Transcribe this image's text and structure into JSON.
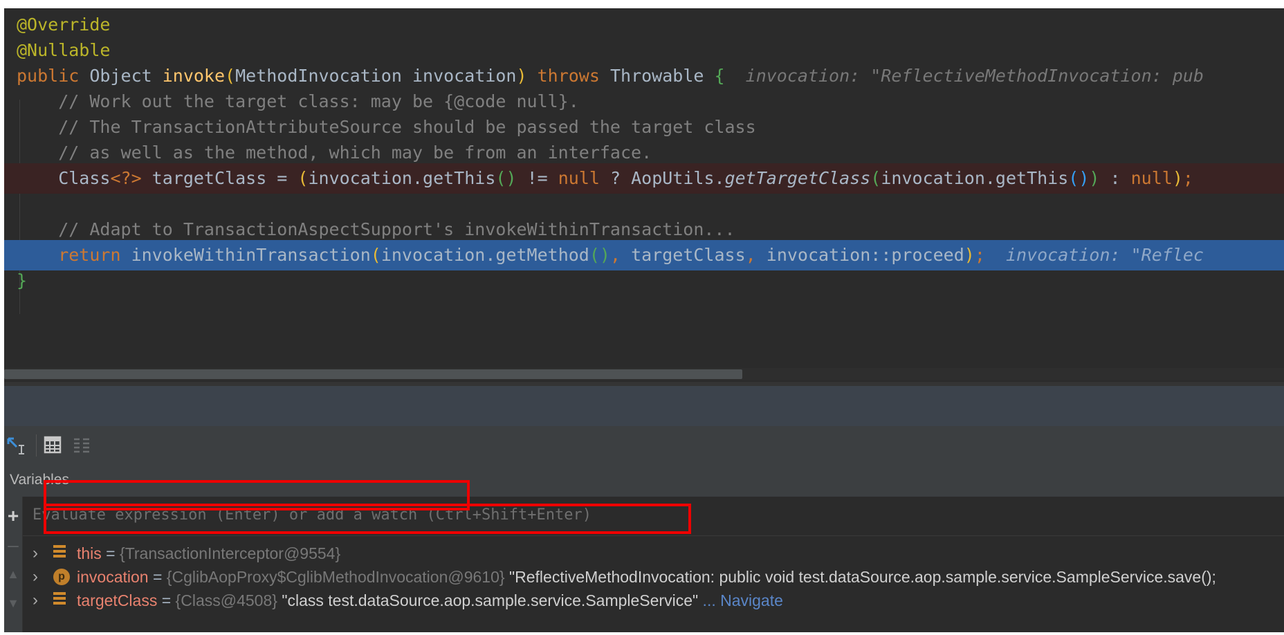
{
  "editor": {
    "lines": {
      "l1": "@Override",
      "l2": "@Nullable",
      "l3_public": "public ",
      "l3_type": "Object ",
      "l3_method": "invoke",
      "l3_open": "(",
      "l3_params": "MethodInvocation invocation",
      "l3_close": ")",
      "l3_throws": " throws ",
      "l3_throwable": "Throwable ",
      "l3_brace": "{",
      "l3_inline": "  invocation: \"ReflectiveMethodInvocation: pub",
      "l4": "    // Work out the target class: may be {@code null}.",
      "l5": "    // The TransactionAttributeSource should be passed the target class",
      "l6": "    // as well as the method, which may be from an interface.",
      "l7_a": "    Class",
      "l7_b": "<?>",
      "l7_c": " targetClass = ",
      "l7_d": "(",
      "l7_e": "invocation.getThis",
      "l7_f": "()",
      "l7_g": " != ",
      "l7_h": "null",
      "l7_i": " ? AopUtils.",
      "l7_j": "getTargetClass",
      "l7_k": "(",
      "l7_l": "invocation.getThis",
      "l7_m": "()",
      "l7_n": ")",
      "l7_o": " : ",
      "l7_p": "null",
      "l7_q": ")",
      "l7_r": ";",
      "l9": "    // Adapt to TransactionAspectSupport's invokeWithinTransaction...",
      "l10_a": "    return ",
      "l10_b": "invokeWithinTransaction",
      "l10_c": "(",
      "l10_d": "invocation.getMethod",
      "l10_e": "()",
      "l10_f": ", ",
      "l10_g": "targetClass",
      "l10_h": ", ",
      "l10_i": "invocation::proceed",
      "l10_j": ")",
      "l10_k": ";",
      "l10_inline": "  invocation: \"Reflec",
      "l11": "}"
    }
  },
  "toolbar": {
    "restore_icon": "restore-layout-icon",
    "table_icon": "table-icon",
    "columns_icon": "columns-icon"
  },
  "variables": {
    "title": "Variables",
    "watch_placeholder": "Evaluate expression (Enter) or add a watch (Ctrl+Shift+Enter)",
    "rows": [
      {
        "name": "this",
        "eq": " = ",
        "type": "{TransactionInterceptor@9554}",
        "value": "",
        "icon": "field-icon"
      },
      {
        "name": "invocation",
        "eq": " = ",
        "type": "{CglibAopProxy$CglibMethodInvocation@9610}",
        "value": " \"ReflectiveMethodInvocation: public void test.dataSource.aop.sample.service.SampleService.save();",
        "icon": "parameter-icon"
      },
      {
        "name": "targetClass",
        "eq": " = ",
        "type": "{Class@4508}",
        "value": " \"class test.dataSource.aop.sample.service.SampleService\"",
        "navigate": " ... Navigate",
        "icon": "field-icon"
      }
    ]
  },
  "colors": {
    "editor_bg": "#2b2b2b",
    "keyword": "#cc7832",
    "annotation": "#bbb529",
    "method": "#ffc66d",
    "comment": "#808080",
    "exec_line": "#2d5c99",
    "breakpoint_line": "#3a2323",
    "highlight_box": "#ee0000"
  }
}
